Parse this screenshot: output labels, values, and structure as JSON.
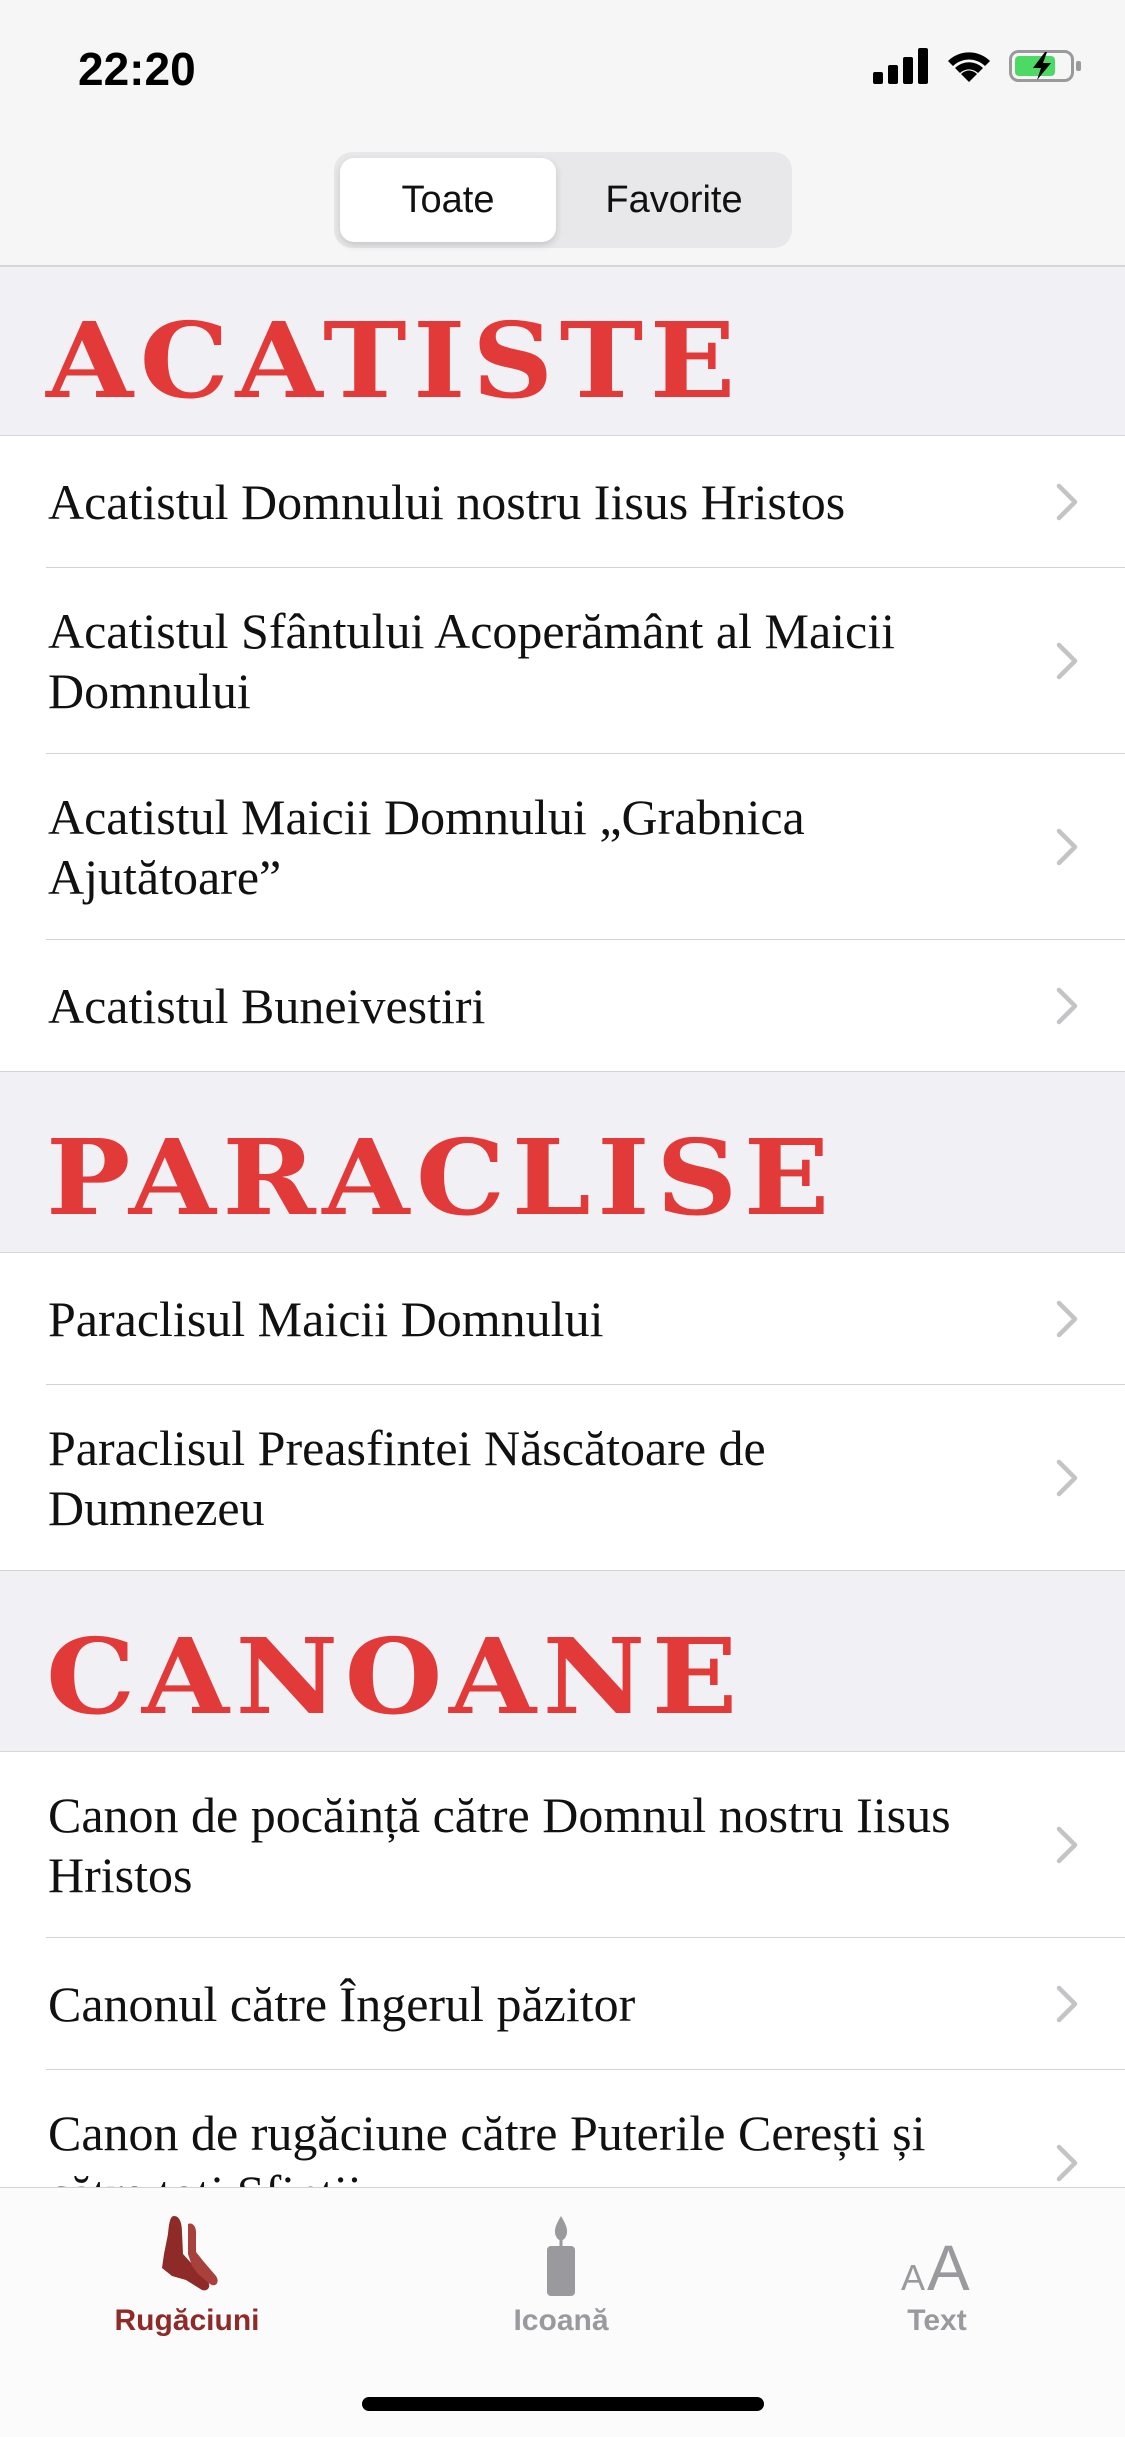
{
  "status": {
    "time": "22:20",
    "icons": [
      "cellular-signal-icon",
      "wifi-icon",
      "battery-charging-icon"
    ],
    "battery_color": "#4cd964"
  },
  "segmented": {
    "options": [
      "Toate",
      "Favorite"
    ],
    "selected": "Toate"
  },
  "colors": {
    "section_title": "#e13a38",
    "tab_active": "#8e2a28",
    "tab_inactive": "#9a9a9e"
  },
  "sections": [
    {
      "title": "ACATISTE",
      "items": [
        "Acatistul Domnului nostru Iisus Hristos",
        "Acatistul Sfântului Acoperământ al Maicii Domnului",
        "Acatistul Maicii Domnului „Grabnica Ajutătoare”",
        "Acatistul Buneivestiri"
      ]
    },
    {
      "title": "PARACLISE",
      "items": [
        "Paraclisul Maicii Domnului",
        "Paraclisul Preasfintei Născătoare de Dumnezeu"
      ]
    },
    {
      "title": "CANOANE",
      "items": [
        "Canon de pocăință către Domnul nostru Iisus Hristos",
        "Canonul către Îngerul păzitor",
        "Canon de rugăciune către Puterile Cerești și către toți Sfinții"
      ]
    }
  ],
  "tabs": [
    {
      "label": "Rugăciuni",
      "icon": "praying-hands-icon",
      "active": true
    },
    {
      "label": "Icoană",
      "icon": "candle-icon",
      "active": false
    },
    {
      "label": "Text",
      "icon": "text-size-icon",
      "active": false
    }
  ]
}
